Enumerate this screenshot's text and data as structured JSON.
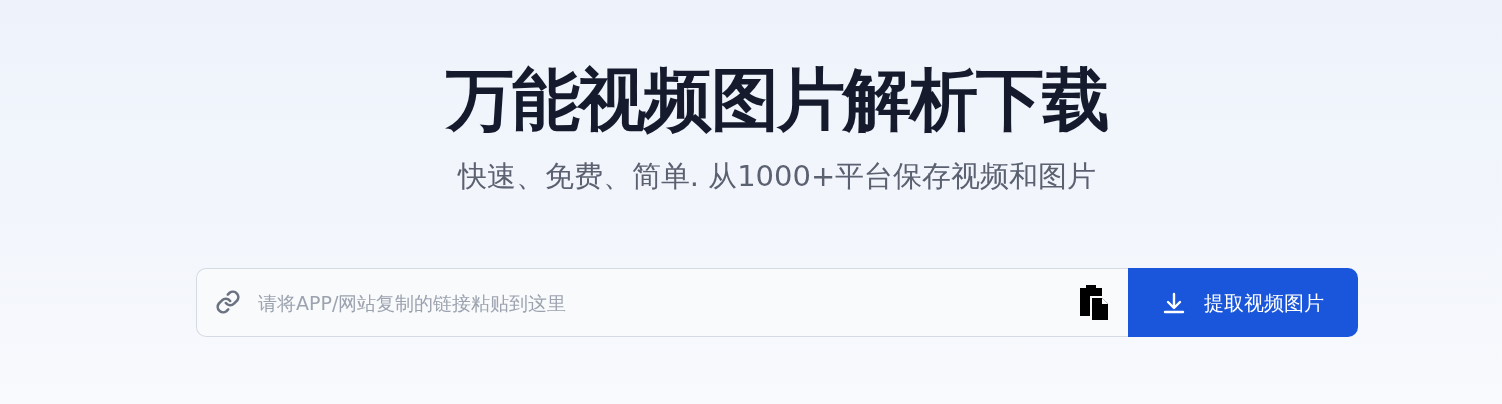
{
  "hero": {
    "title": "万能视频图片解析下载",
    "subtitle": "快速、免费、简单. 从1000+平台保存视频和图片"
  },
  "search": {
    "placeholder": "请将APP/网站复制的链接粘贴到这里"
  },
  "button": {
    "label": "提取视频图片"
  }
}
